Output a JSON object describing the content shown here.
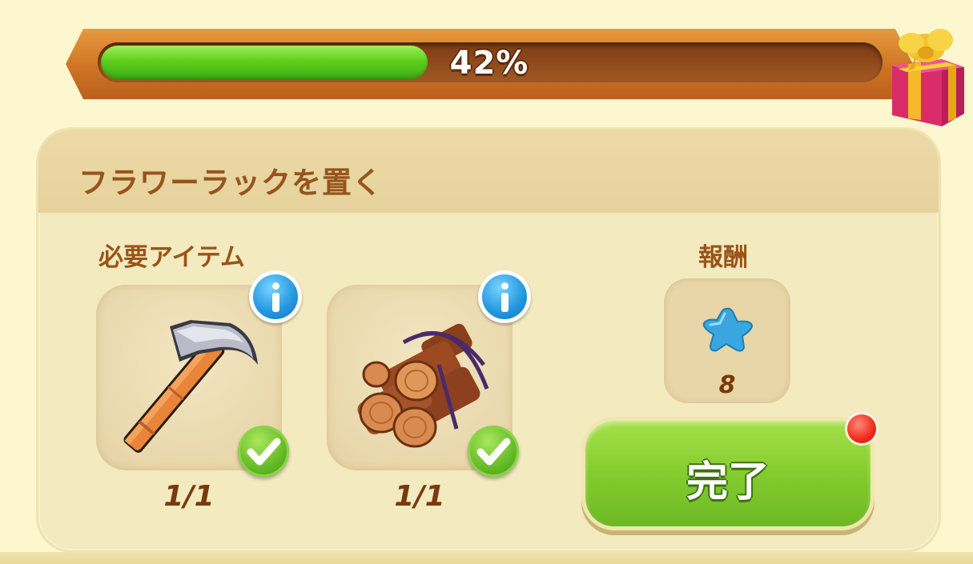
{
  "progress": {
    "label": "42%",
    "value": 0.42
  },
  "quest": {
    "title": "フラワーラックを置く",
    "required_label": "必要アイテム",
    "reward_label": "報酬",
    "items": [
      {
        "icon": "hammer-icon",
        "count": "1/1",
        "complete": true
      },
      {
        "icon": "logs-icon",
        "count": "1/1",
        "complete": true
      }
    ],
    "reward": {
      "icon": "blue-star-icon",
      "amount": "8"
    },
    "complete_button": "完了"
  },
  "colors": {
    "progress_fill": "#5fcf1e",
    "frame": "#cf7424",
    "panel": "#f3eac0",
    "title_text": "#97541c",
    "button": "#84cc2e",
    "info_badge": "#2196df",
    "notify": "#f02a1a"
  }
}
